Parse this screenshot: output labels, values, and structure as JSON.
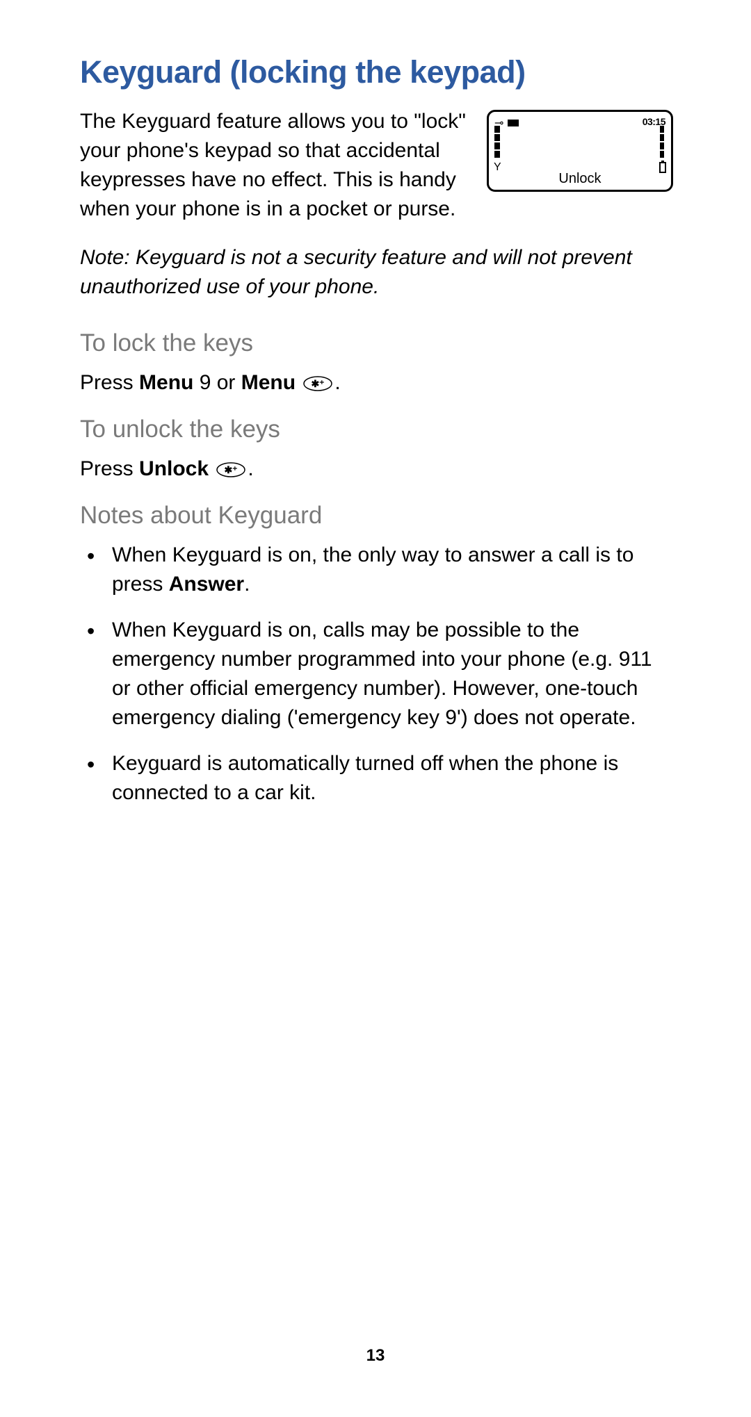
{
  "title": "Keyguard (locking the keypad)",
  "intro": "The Keyguard feature allows you to \"lock\" your phone's keypad so that accidental keypresses have no effect. This is handy when your phone is in a pocket or purse.",
  "phone_screen": {
    "time": "03:15",
    "unlock_label": "Unlock"
  },
  "note_prefix": "Note:",
  "note_body": " Keyguard is not a security feature and will not prevent unauthorized use of your phone.",
  "sections": {
    "lock": {
      "heading": "To lock the keys",
      "text_prefix": "Press ",
      "menu": "Menu",
      "text_mid": " 9 or ",
      "text_end": "."
    },
    "unlock": {
      "heading": "To unlock the keys",
      "text_prefix": "Press ",
      "unlock": "Unlock",
      "text_end": "."
    },
    "notes": {
      "heading": "Notes about Keyguard",
      "bullets": [
        {
          "pre": "When Keyguard is on, the only way to answer a call is to press ",
          "bold": "Answer",
          "post": "."
        },
        {
          "pre": "When Keyguard is on, calls may be possible to the emergency number programmed into your phone (e.g. 911 or other official emergency number). However, one-touch emergency dialing ('emergency key 9') does not operate.",
          "bold": "",
          "post": ""
        },
        {
          "pre": "Keyguard is automatically turned off when the phone is connected to a car kit.",
          "bold": "",
          "post": ""
        }
      ]
    }
  },
  "page_number": "13"
}
